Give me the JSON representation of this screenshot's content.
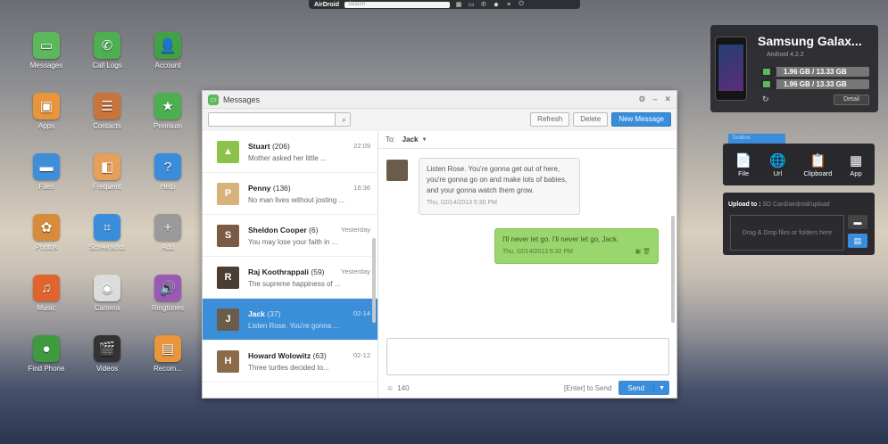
{
  "topbar": {
    "brand": "AirDroid",
    "search_placeholder": "Search"
  },
  "desktop": [
    {
      "label": "Messages",
      "icon": "message-icon",
      "color": "#5cb85c",
      "glyph": "▭"
    },
    {
      "label": "Call Logs",
      "icon": "phone-icon",
      "color": "#4caf50",
      "glyph": "✆"
    },
    {
      "label": "Account",
      "icon": "account-icon",
      "color": "#43a047",
      "glyph": "👤"
    },
    {
      "label": "Apps",
      "icon": "apps-icon",
      "color": "#e8953b",
      "glyph": "▣"
    },
    {
      "label": "Contacts",
      "icon": "contacts-icon",
      "color": "#c9743a",
      "glyph": "☰"
    },
    {
      "label": "Premium",
      "icon": "star-icon",
      "color": "#4caf50",
      "glyph": "★"
    },
    {
      "label": "Files",
      "icon": "folder-icon",
      "color": "#3e8fd8",
      "glyph": "▬"
    },
    {
      "label": "Frequent",
      "icon": "frequent-icon",
      "color": "#e6a05a",
      "glyph": "◧"
    },
    {
      "label": "Help",
      "icon": "help-icon",
      "color": "#3a8ddb",
      "glyph": "?"
    },
    {
      "label": "Photos",
      "icon": "photos-icon",
      "color": "#d98b3c",
      "glyph": "✿"
    },
    {
      "label": "Screenshot",
      "icon": "crop-icon",
      "color": "#3a8ddb",
      "glyph": "⌗"
    },
    {
      "label": "Add",
      "icon": "add-icon",
      "color": "#9a9a9a",
      "glyph": "+"
    },
    {
      "label": "Music",
      "icon": "music-icon",
      "color": "#e0642e",
      "glyph": "♫"
    },
    {
      "label": "Camera",
      "icon": "camera-icon",
      "color": "#dcdcdc",
      "glyph": "◉"
    },
    {
      "label": "Ringtones",
      "icon": "speaker-icon",
      "color": "#9b59b6",
      "glyph": "🔊"
    },
    {
      "label": "Find Phone",
      "icon": "find-phone-icon",
      "color": "#3f9a3f",
      "glyph": "●"
    },
    {
      "label": "Videos",
      "icon": "video-icon",
      "color": "#333333",
      "glyph": "🎬"
    },
    {
      "label": "Recom...",
      "icon": "recommend-icon",
      "color": "#e8953b",
      "glyph": "▤"
    }
  ],
  "window": {
    "title": "Messages",
    "search_placeholder": "",
    "refresh": "Refresh",
    "delete": "Delete",
    "new_message": "New Message"
  },
  "threads": [
    {
      "name": "Stuart",
      "count": "(206)",
      "time": "22:09",
      "preview": "Mother asked her little ...",
      "color": "#8bc34a",
      "initial": "▲"
    },
    {
      "name": "Penny",
      "count": "(136)",
      "time": "16:36",
      "preview": "No man lives without josting ...",
      "color": "#d8b27a",
      "initial": "P"
    },
    {
      "name": "Sheldon Cooper",
      "count": "(6)",
      "time": "Yesterday",
      "preview": "You may lose your faith in ...",
      "color": "#7a5c45",
      "initial": "S"
    },
    {
      "name": "Raj Koothrappali",
      "count": "(59)",
      "time": "Yesterday",
      "preview": "The supreme happiness of ...",
      "color": "#4a3d33",
      "initial": "R"
    },
    {
      "name": "Jack",
      "count": "(37)",
      "time": "02-14",
      "preview": "Listen Rose. You're gonna ...",
      "color": "#6a5b4a",
      "initial": "J"
    },
    {
      "name": "Howard Wolowitz",
      "count": "(63)",
      "time": "02-12",
      "preview": "Three turtles decided to...",
      "color": "#8a6a4a",
      "initial": "H"
    }
  ],
  "conversation": {
    "to_label": "To:",
    "to_name": "Jack",
    "incoming": {
      "text": "Listen Rose. You're gonna get out of here, you're gonna go on and make lots of babies, and your gonna watch them grow.",
      "time": "Thu, 02/14/2013 5:30 PM"
    },
    "outgoing": {
      "text": "I'll never let go. I'll never let go, Jack.",
      "time": "Thu, 02/14/2013 5:32 PM"
    },
    "char_count": "140",
    "hint": "[Enter] to Send",
    "send": "Send"
  },
  "device": {
    "name": "Samsung Galax...",
    "version": "Android 4.2.2",
    "storage1": "1.96 GB / 13.33 GB",
    "storage1_fraction": 0.15,
    "storage2": "1.96 GB / 13.33 GB",
    "storage2_fraction": 0.15,
    "detail": "Detail"
  },
  "toolbox": {
    "tab": "Toolbox",
    "tools": [
      {
        "label": "File",
        "icon": "file-icon",
        "glyph": "📄"
      },
      {
        "label": "Url",
        "icon": "globe-icon",
        "glyph": "🌐"
      },
      {
        "label": "Clipboard",
        "icon": "clipboard-icon",
        "glyph": "📋"
      },
      {
        "label": "App",
        "icon": "app-grid-icon",
        "glyph": "▦"
      }
    ],
    "upload_label": "Upload to :",
    "upload_path": "SD Card/airdroid/upload",
    "drop_text": "Drag & Drop files or folders here"
  }
}
